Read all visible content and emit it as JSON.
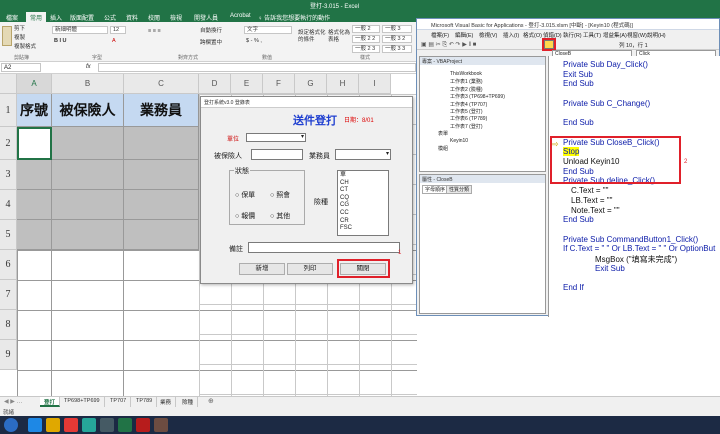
{
  "excel": {
    "title": "登打-3.015 - Excel",
    "tabs": [
      "檔案",
      "常用",
      "插入",
      "版面配置",
      "公式",
      "資料",
      "校閱",
      "檢視",
      "開發人員",
      "Acrobat",
      "♀ 告訴我您想要執行的動作"
    ],
    "active_tab": "常用",
    "clipboard": {
      "cut": "剪下",
      "copy": "複製",
      "painter": "複製格式",
      "group": "剪貼簿"
    },
    "font": {
      "name": "新細明體",
      "size": "12",
      "group": "字型"
    },
    "align_group": "對齊方式",
    "wrap_text": "自動換行",
    "merge": "跨欄置中",
    "number_format": "文字",
    "number_group": "數值",
    "styles": {
      "cond": "設定格式化的條件",
      "table": "格式化為表格",
      "s1": "一般 2",
      "s2": "一般 3",
      "s3": "一般 2 2",
      "s4": "一般 3 2",
      "s5": "一般 2 3",
      "s6": "一般 3 3",
      "group": "樣式"
    },
    "name_box": "A2",
    "fx": "fx",
    "columns": [
      "A",
      "B",
      "C",
      "D",
      "E",
      "F",
      "G",
      "H",
      "I"
    ],
    "rows": [
      "1",
      "2",
      "3",
      "4",
      "5",
      "6",
      "7",
      "8",
      "9"
    ],
    "headers": {
      "a": "序號",
      "b": "被保險人",
      "c": "業務員"
    },
    "sheets": [
      "登打",
      "TP698+TP699",
      "TP707",
      "TP789",
      "業務",
      "險種"
    ],
    "active_sheet": "登打",
    "status": "就緒"
  },
  "form": {
    "title": "登打系統v3.0 登錄表",
    "heading": "送件登打",
    "date_label": "日期：8/01",
    "unit_label": "單位",
    "insured_label": "被保險人",
    "agent_label": "業務員",
    "status_group": "狀態",
    "opt_insure": "保單",
    "opt_renew": "照會",
    "opt_quote": "報價",
    "opt_other": "其他",
    "risk_label": "險種",
    "risk_items": [
      "車",
      "CH",
      "CT",
      "CQ",
      "CG",
      "CC",
      "CR",
      "FSC"
    ],
    "note_label": "備註",
    "btn_add": "新增",
    "btn_print": "列印",
    "btn_close": "關閉",
    "callout1": "1"
  },
  "vba": {
    "title": "Microsoft Visual Basic for Applications - 登打-3.015.xlsm [中斷] - [Keyin10 (程式碼)]",
    "menu": [
      "檔案(F)",
      "編輯(E)",
      "檢視(V)",
      "插入(I)",
      "格式(O)",
      "偵錯(D)",
      "執行(R)",
      "工具(T)",
      "增益集(A)",
      "視窗(W)",
      "說明(H)"
    ],
    "position": "列 10，行 1",
    "project_title": "專案 - VBAProject",
    "tree": [
      "ThisWorkbook",
      "工作表1 (業務)",
      "工作表2 (險種)",
      "工作表3 (TP698+TP699)",
      "工作表4 (TP707)",
      "工作表5 (登打)",
      "工作表6 (TP789)",
      "工作表7 (登打)",
      "表單",
      "Keyin10",
      "模組"
    ],
    "props_title": "屬性 - CloseB",
    "props_tabs": [
      "字母順序",
      "性質分類"
    ],
    "obj_combo": "CloseB",
    "proc_combo": "Click",
    "code": [
      {
        "t": "Private Sub Day_Click()",
        "kw": true
      },
      {
        "t": "Exit Sub",
        "kw": true
      },
      {
        "t": "End Sub",
        "kw": true
      },
      {
        "t": "",
        "kw": false
      },
      {
        "t": "Private Sub C_Change()",
        "kw": true
      },
      {
        "t": "",
        "kw": false
      },
      {
        "t": "End Sub",
        "kw": true
      },
      {
        "t": "",
        "kw": false
      },
      {
        "t": "Private Sub CloseB_Click()",
        "kw": true
      },
      {
        "t": "Stop",
        "kw": true
      },
      {
        "t": "Unload Keyin10",
        "kw": false
      },
      {
        "t": "End Sub",
        "kw": true
      },
      {
        "t": "Private Sub deline_Click()",
        "kw": true
      },
      {
        "t": "C.Text = \"\"",
        "kw": false
      },
      {
        "t": "LB.Text = \"\"",
        "kw": false
      },
      {
        "t": "Note.Text = \"\"",
        "kw": false
      },
      {
        "t": "End Sub",
        "kw": true
      },
      {
        "t": "",
        "kw": false
      },
      {
        "t": "Private Sub CommandButton1_Click()",
        "kw": true
      },
      {
        "t": "If C.Text = \" \" Or LB.Text = \" \" Or OptionBut",
        "kw": true
      },
      {
        "t": "MsgBox (\"填寫未完成\")",
        "kw": false
      },
      {
        "t": "Exit Sub",
        "kw": true
      },
      {
        "t": "",
        "kw": false
      },
      {
        "t": "End If",
        "kw": true
      }
    ],
    "callout2": "2"
  },
  "colors": {
    "excel_green": "#217346",
    "header_blue": "#c5d9f1",
    "gray_fill": "#bfbfbf",
    "callout_red": "#e0202a",
    "code_blue": "#0a1aa8",
    "highlight": "#ffff00"
  }
}
